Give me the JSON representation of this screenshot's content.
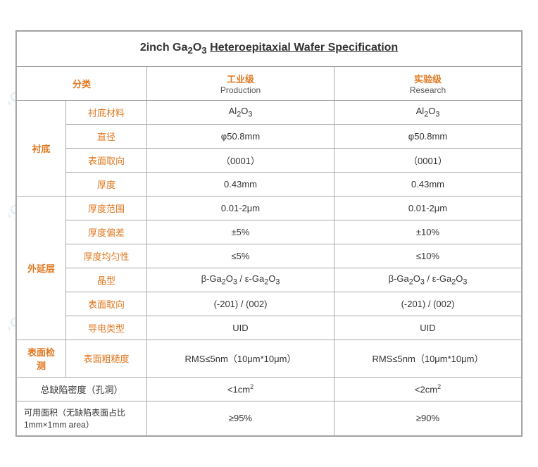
{
  "title": "2inch Ga₂O₃ Heteroepitaxial Wafer Specification",
  "watermark": "MIG",
  "headers": {
    "category": "分类",
    "industrial_grade": "工业级",
    "industrial_sub": "Production",
    "research_grade": "实验级",
    "research_sub": "Research"
  },
  "sections": {
    "substrate": {
      "label": "衬底",
      "rows": [
        {
          "sub": "衬底材料",
          "production": "Al₂O₃",
          "research": "Al₂O₃"
        },
        {
          "sub": "直径",
          "production": "φ50.8mm",
          "research": "φ50.8mm"
        },
        {
          "sub": "表面取向",
          "production": "（0001）",
          "research": "（0001）"
        },
        {
          "sub": "厚度",
          "production": "0.43mm",
          "research": "0.43mm"
        }
      ]
    },
    "epi_layer": {
      "label": "外延层",
      "rows": [
        {
          "sub": "厚度范围",
          "production": "0.01-2μm",
          "research": "0.01-2μm"
        },
        {
          "sub": "厚度偏差",
          "production": "±5%",
          "research": "±10%"
        },
        {
          "sub": "厚度均匀性",
          "production": "≤5%",
          "research": "≤10%"
        },
        {
          "sub": "晶型",
          "production": "β-Ga₂O₃ / ε-Ga₂O₃",
          "research": "β-Ga₂O₃ / ε-Ga₂O₃"
        },
        {
          "sub": "表面取向",
          "production": "(-201) / (002)",
          "research": "(-201) / (002)"
        },
        {
          "sub": "导电类型",
          "production": "UID",
          "research": "UID"
        }
      ]
    },
    "surface_inspection": {
      "label": "表面检测",
      "rows": [
        {
          "sub": "表面粗糙度",
          "production": "RMS≤5nm（10μm*10μm）",
          "research": "RMS≤5nm（10μm*10μm）"
        }
      ]
    },
    "defect_density": {
      "label": "总缺陷密度（孔洞）",
      "production": "<1cm²",
      "research": "<2cm²"
    },
    "usable_area": {
      "label": "可用面积（无缺陷表面占比 1mm×1mm area）",
      "production": "≥95%",
      "research": "≥90%"
    }
  }
}
